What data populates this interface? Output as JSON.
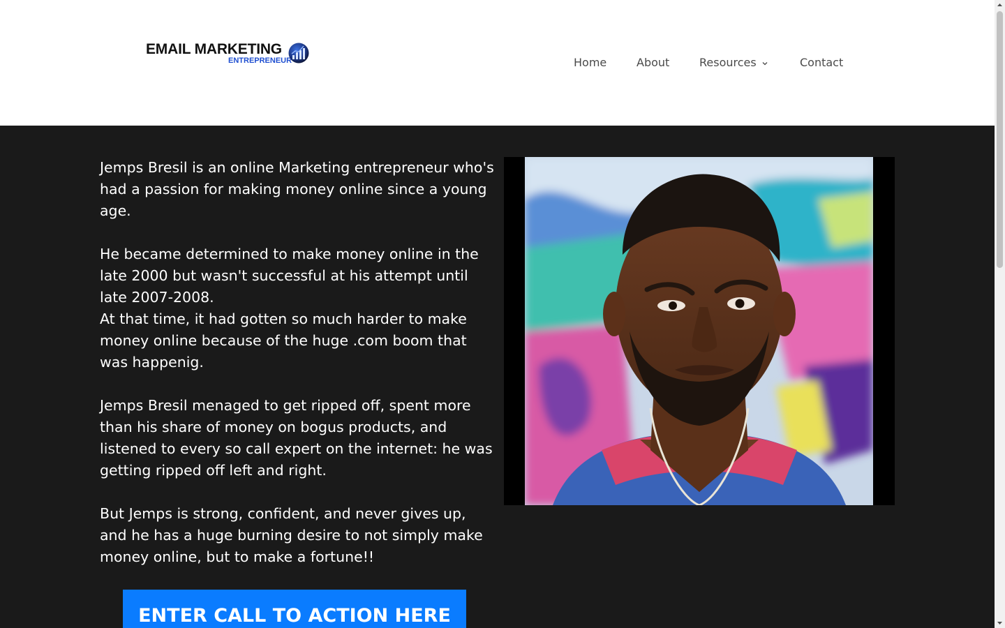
{
  "logo": {
    "main": "EMAIL MARKETING",
    "sub": "ENTREPRENEUR",
    "icon": "bar-chart-globe-icon",
    "colors": {
      "main": "#111111",
      "sub": "#1f4fd1",
      "badge": "#1e3a8a"
    }
  },
  "nav": {
    "items": [
      {
        "label": "Home"
      },
      {
        "label": "About"
      },
      {
        "label": "Resources",
        "icon": "chevron-down-icon"
      },
      {
        "label": "Contact"
      }
    ]
  },
  "bio": {
    "p1": "Jemps Bresil is an online Marketing entrepreneur who's had a passion for making money online since a young age.",
    "p2": "He became determined to make money online in the late 2000 but wasn't successful at his attempt until late 2007-2008.",
    "p3": "At that time, it had gotten so much harder to make money online because of the huge .com boom that was happenig.",
    "p4": "Jemps Bresil menaged to get ripped off, spent more than his share of money on bogus products, and listened to every so call expert on the internet: he was getting ripped off left and right.",
    "p5": "But Jemps is strong, confident, and never gives up, and he has a huge burning desire to not simply make money online, but to make a fortune!!"
  },
  "cta": {
    "label": "ENTER CALL TO ACTION HERE",
    "color": "#0a7cff"
  },
  "colors": {
    "main_bg": "#1a1a1a",
    "header_bg": "#ffffff",
    "nav_text": "#4a4a4a"
  }
}
